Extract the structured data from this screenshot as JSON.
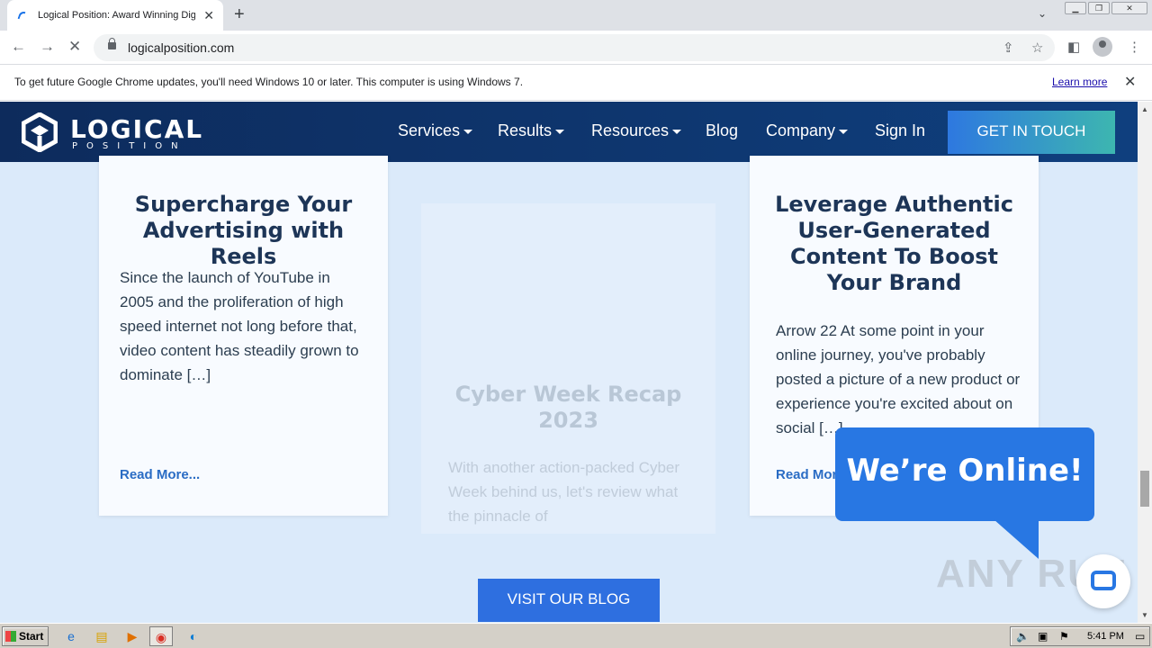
{
  "browser": {
    "tab_title": "Logical Position: Award Winning Digi",
    "url": "logicalposition.com",
    "infobar_message": "To get future Google Chrome updates, you'll need Windows 10 or later. This computer is using Windows 7.",
    "infobar_link": "Learn more"
  },
  "site": {
    "logo_main": "LOGICAL",
    "logo_sub": "POSITION",
    "nav": {
      "services": "Services",
      "results": "Results",
      "resources": "Resources",
      "blog": "Blog",
      "company": "Company",
      "sign_in": "Sign In"
    },
    "cta": "GET IN TOUCH"
  },
  "cards": [
    {
      "title": "Supercharge Your Advertising with Reels",
      "excerpt": "Since the launch of YouTube in 2005 and the proliferation of high speed internet not long before that, video content has steadily grown to dominate […]",
      "link": "Read More..."
    },
    {
      "title": "Cyber Week Recap 2023",
      "excerpt": "With another action-packed Cyber Week behind us, let's review what the pinnacle of"
    },
    {
      "title": "Leverage Authentic User-Generated Content To Boost Your Brand",
      "excerpt": "Arrow 22 At some point in your online journey, you've probably posted a picture of a new product or experience you're excited about on social […]",
      "link": "Read More..."
    }
  ],
  "blog_button": "VISIT OUR BLOG",
  "chat": {
    "bubble": "We’re Online!"
  },
  "watermark": "ANY RUN",
  "taskbar": {
    "start": "Start",
    "clock": "5:41 PM"
  },
  "colors": {
    "header_bg": "#0d2b5c",
    "page_bg": "#dbeafa",
    "cta_gradient_start": "#2e78e0",
    "cta_gradient_end": "#3db6b0",
    "accent_blue": "#2e6fe0"
  }
}
